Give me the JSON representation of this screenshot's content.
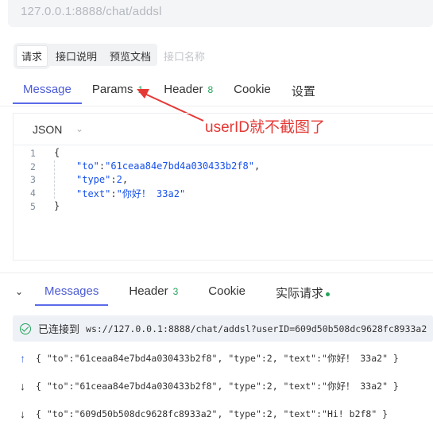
{
  "url": "127.0.0.1:8888/chat/addsl",
  "top_tabs": [
    "请求",
    "接口说明",
    "预览文档",
    "接口名称"
  ],
  "request_tabs": {
    "message": "Message",
    "params": "Params",
    "params_count": "1",
    "header": "Header",
    "header_count": "8",
    "cookie": "Cookie",
    "settings": "设置"
  },
  "editor": {
    "format": "JSON",
    "line_numbers": [
      "1",
      "2",
      "3",
      "4",
      "5"
    ],
    "lines": {
      "open": "{",
      "to_key": "\"to\"",
      "to_val": "\"61ceaa84e7bd4a030433b2f8\"",
      "type_key": "\"type\"",
      "type_val": "2",
      "text_key": "\"text\"",
      "text_val": "\"你好！ 33a2\"",
      "close": "}"
    }
  },
  "annotation": "userID就不截图了",
  "response_tabs": {
    "messages": "Messages",
    "header": "Header",
    "header_count": "3",
    "cookie": "Cookie",
    "actual_request": "实际请求"
  },
  "connection": {
    "label": "已连接到",
    "url": "ws://127.0.0.1:8888/chat/addsl?userID=609d50b508dc9628fc8933a2"
  },
  "messages": [
    {
      "direction": "up",
      "text": "{ \"to\":\"61ceaa84e7bd4a030433b2f8\", \"type\":2, \"text\":\"你好！ 33a2\" }"
    },
    {
      "direction": "down",
      "text": "{ \"to\":\"61ceaa84e7bd4a030433b2f8\", \"type\":2, \"text\":\"你好！ 33a2\" }"
    },
    {
      "direction": "down",
      "text": "{ \"to\":\"609d50b508dc9628fc8933a2\", \"type\":2, \"text\":\"Hi! b2f8\" }"
    }
  ],
  "colors": {
    "accent": "#4b5bd6",
    "success": "#22a35a",
    "annotation": "#e53935",
    "json_value": "#1750eb"
  },
  "icons": {
    "format_dropdown": "chevron-down-icon",
    "collapse": "chevron-down-icon",
    "connected": "check-circle-icon",
    "sent": "arrow-up-icon",
    "received": "arrow-down-icon",
    "annotation_arrow": "red-arrow-icon"
  }
}
